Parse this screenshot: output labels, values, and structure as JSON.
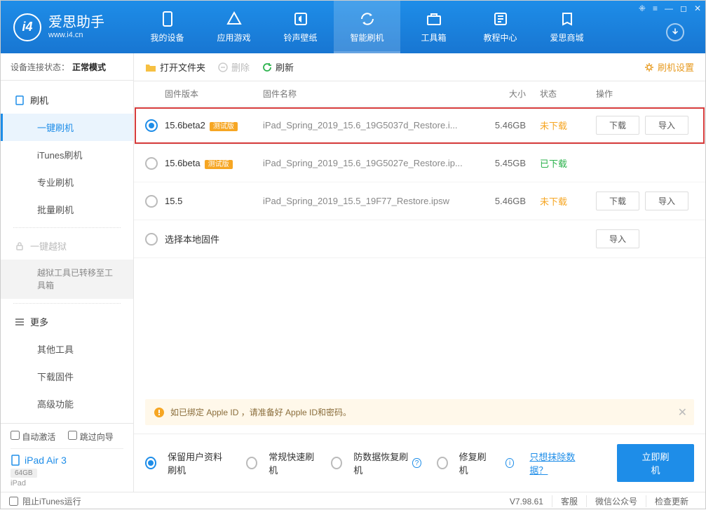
{
  "titlebar": {
    "icons": [
      "⁜",
      "≡",
      "—",
      "◻",
      "✕"
    ]
  },
  "logo": {
    "title": "爱思助手",
    "url": "www.i4.cn"
  },
  "nav": [
    {
      "label": "我的设备"
    },
    {
      "label": "应用游戏"
    },
    {
      "label": "铃声壁纸"
    },
    {
      "label": "智能刷机",
      "active": true
    },
    {
      "label": "工具箱"
    },
    {
      "label": "教程中心"
    },
    {
      "label": "爱思商城"
    }
  ],
  "status": {
    "label": "设备连接状态：",
    "value": "正常模式"
  },
  "sidebar": {
    "flash_cat": "刷机",
    "items": [
      "一键刷机",
      "iTunes刷机",
      "专业刷机",
      "批量刷机"
    ],
    "jail_cat": "一键越狱",
    "jail_note": "越狱工具已转移至工具箱",
    "more_cat": "更多",
    "more_items": [
      "其他工具",
      "下载固件",
      "高级功能"
    ]
  },
  "device_box": {
    "auto_activate": "自动激活",
    "skip_guide": "跳过向导",
    "name": "iPad Air 3",
    "storage": "64GB",
    "type": "iPad"
  },
  "toolbar": {
    "open": "打开文件夹",
    "delete": "删除",
    "refresh": "刷新",
    "settings": "刷机设置"
  },
  "columns": {
    "version": "固件版本",
    "name": "固件名称",
    "size": "大小",
    "status": "状态",
    "ops": "操作"
  },
  "buttons": {
    "download": "下载",
    "import": "导入"
  },
  "rows": [
    {
      "checked": true,
      "highlight": true,
      "version": "15.6beta2",
      "badge": "测试版",
      "name": "iPad_Spring_2019_15.6_19G5037d_Restore.i...",
      "size": "5.46GB",
      "status": "未下载",
      "status_cls": "st-not",
      "ops": [
        "download",
        "import"
      ]
    },
    {
      "checked": false,
      "version": "15.6beta",
      "badge": "测试版",
      "name": "iPad_Spring_2019_15.6_19G5027e_Restore.ip...",
      "size": "5.45GB",
      "status": "已下载",
      "status_cls": "st-done",
      "ops": []
    },
    {
      "checked": false,
      "version": "15.5",
      "badge": "",
      "name": "iPad_Spring_2019_15.5_19F77_Restore.ipsw",
      "size": "5.46GB",
      "status": "未下载",
      "status_cls": "st-not",
      "ops": [
        "download",
        "import"
      ]
    },
    {
      "checked": false,
      "version": "选择本地固件",
      "badge": "",
      "name": "",
      "size": "",
      "status": "",
      "status_cls": "",
      "ops": [
        "import"
      ]
    }
  ],
  "alert": "如已绑定 Apple ID ，请准备好 Apple ID和密码。",
  "modes": {
    "keep": "保留用户资料刷机",
    "fast": "常规快速刷机",
    "recover": "防数据恢复刷机",
    "repair": "修复刷机",
    "erase_link": "只想抹除数据？",
    "go": "立即刷机"
  },
  "footer": {
    "block_itunes": "阻止iTunes运行",
    "version": "V7.98.61",
    "service": "客服",
    "wechat": "微信公众号",
    "update": "检查更新"
  }
}
